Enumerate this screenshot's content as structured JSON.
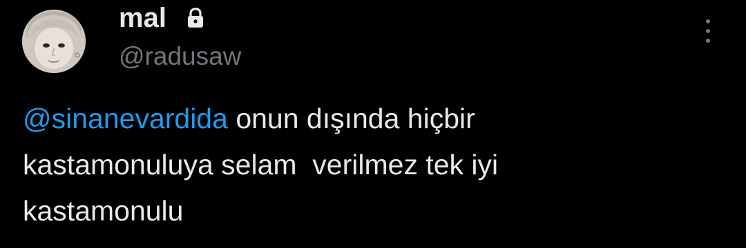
{
  "author": {
    "display_name": "mal",
    "handle": "@radusaw",
    "protected_icon": "lock-icon",
    "avatar_icon": "profile-photo"
  },
  "menu": {
    "icon": "more-vertical-icon"
  },
  "tweet": {
    "mention": "@sinanevardida",
    "line1_rest": " onun dışında hiçbir",
    "line2": "kastamonuluya selam  verilmez tek iyi",
    "line3": "kastamonulu"
  },
  "colors": {
    "background": "#000000",
    "text_primary": "#e7e9ea",
    "text_secondary": "#71767b",
    "link": "#1d9bf0"
  }
}
